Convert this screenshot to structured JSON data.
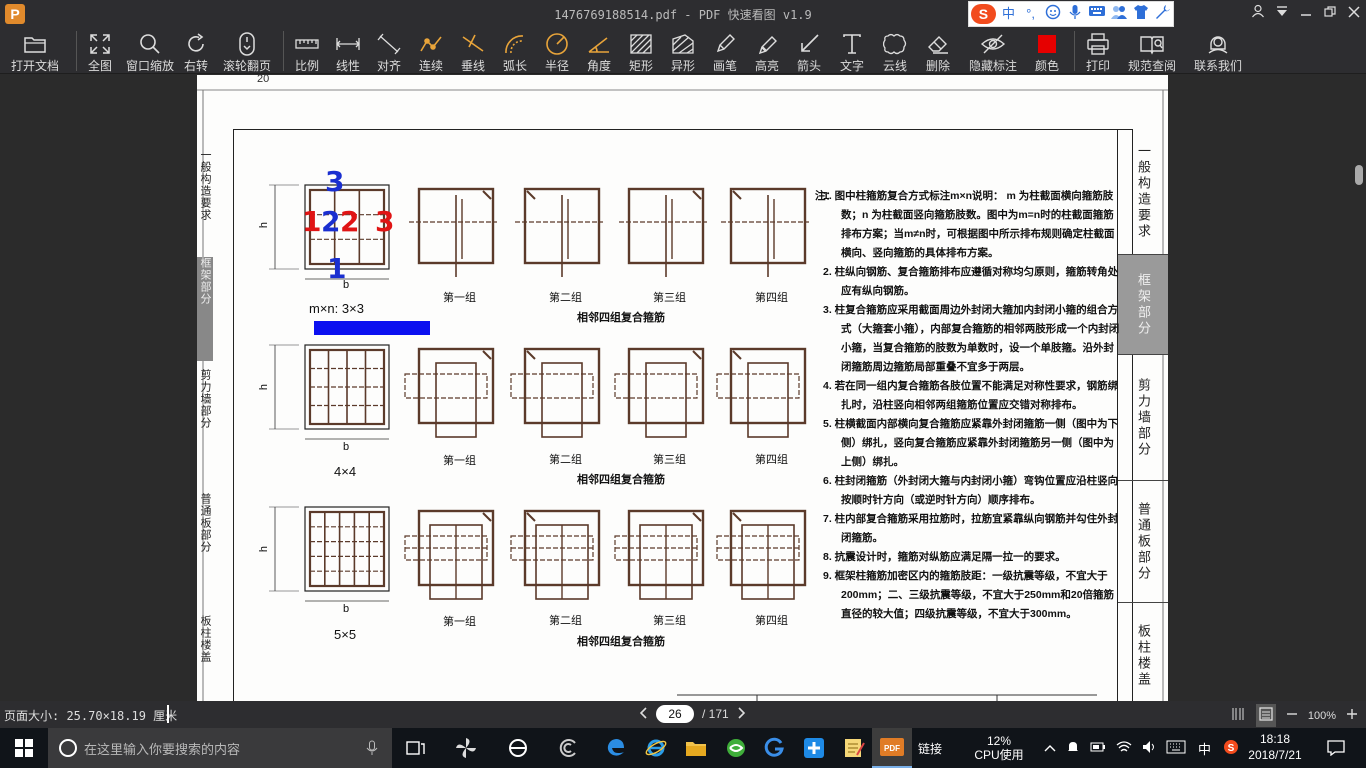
{
  "window": {
    "title": "1476769188514.pdf - PDF 快速看图 v1.9",
    "logo_text": "P",
    "controls": [
      "user-icon",
      "menu-icon",
      "minimize",
      "maximize",
      "close"
    ]
  },
  "ime": {
    "logo": "S",
    "items": [
      "中",
      "°,",
      "☺",
      "🎤",
      "⌨",
      "👥",
      "👕",
      "🔧"
    ]
  },
  "toolbar": {
    "items": [
      {
        "id": "open",
        "label": "打开文档",
        "icon": "folder-icon"
      },
      {
        "id": "fit",
        "label": "全图",
        "icon": "fullscreen-icon"
      },
      {
        "id": "window-zoom",
        "label": "窗口缩放",
        "icon": "magnifier-icon"
      },
      {
        "id": "rotate",
        "label": "右转",
        "icon": "rotate-icon"
      },
      {
        "id": "wheel-page",
        "label": "滚轮翻页",
        "icon": "mouse-icon"
      },
      {
        "id": "scale",
        "label": "比例",
        "icon": "ruler-icon"
      },
      {
        "id": "linear",
        "label": "线性",
        "icon": "linear-dimension-icon"
      },
      {
        "id": "align",
        "label": "对齐",
        "icon": "aligned-dimension-icon"
      },
      {
        "id": "continuous",
        "label": "连续",
        "icon": "continuous-dimension-icon"
      },
      {
        "id": "perpendicular",
        "label": "垂线",
        "icon": "perpendicular-icon"
      },
      {
        "id": "arc-length",
        "label": "弧长",
        "icon": "arc-length-icon"
      },
      {
        "id": "radius",
        "label": "半径",
        "icon": "radius-icon"
      },
      {
        "id": "angle",
        "label": "角度",
        "icon": "angle-icon"
      },
      {
        "id": "rectangle",
        "label": "矩形",
        "icon": "rectangle-area-icon"
      },
      {
        "id": "polygon",
        "label": "异形",
        "icon": "polygon-area-icon"
      },
      {
        "id": "pen",
        "label": "画笔",
        "icon": "pencil-icon"
      },
      {
        "id": "highlight",
        "label": "高亮",
        "icon": "highlighter-icon"
      },
      {
        "id": "arrow",
        "label": "箭头",
        "icon": "arrow-icon"
      },
      {
        "id": "text",
        "label": "文字",
        "icon": "text-icon"
      },
      {
        "id": "cloud",
        "label": "云线",
        "icon": "cloud-icon"
      },
      {
        "id": "delete",
        "label": "删除",
        "icon": "eraser-icon"
      },
      {
        "id": "hide",
        "label": "隐藏标注",
        "icon": "hide-eye-icon"
      },
      {
        "id": "color",
        "label": "颜色",
        "icon": "color-swatch-icon"
      },
      {
        "id": "print",
        "label": "打印",
        "icon": "printer-icon"
      },
      {
        "id": "spec",
        "label": "规范查阅",
        "icon": "book-icon"
      },
      {
        "id": "contact",
        "label": "联系我们",
        "icon": "contact-icon"
      }
    ],
    "color_swatch": "#e60000"
  },
  "document": {
    "page_corner_number": "20",
    "right_tabs": [
      "一般构造要求",
      "框架部分",
      "剪力墙部分",
      "普通板部分",
      "板柱楼盖"
    ],
    "right_active": 1,
    "left_tabs": [
      "一般构造要求",
      "框架部分",
      "剪力墙部分",
      "普通板部分",
      "板柱楼盖"
    ],
    "left_active": 1,
    "rows": [
      {
        "size": "m×n:  3×3",
        "dim_b": "b",
        "dim_h": "h",
        "groups": [
          "第一组",
          "第二组",
          "第三组",
          "第四组"
        ],
        "caption": "相邻四组复合箍筋"
      },
      {
        "size": "4×4",
        "dim_b": "b",
        "dim_h": "h",
        "groups": [
          "第一组",
          "第二组",
          "第三组",
          "第四组"
        ],
        "caption": "相邻四组复合箍筋"
      },
      {
        "size": "5×5",
        "dim_b": "b",
        "dim_h": "h",
        "groups": [
          "第一组",
          "第二组",
          "第三组",
          "第四组"
        ],
        "caption": "相邻四组复合箍筋"
      }
    ],
    "notes_head": "注：",
    "notes": [
      "1. 图中柱箍筋复合方式标注m×n说明：  m 为柱截面横向箍筋肢数；n 为柱截面竖向箍筋肢数。图中为m=n时的柱截面箍筋排布方案；当m≠n时，可根据图中所示排布规则确定柱截面横向、竖向箍筋的具体排布方案。",
      "2. 柱纵向钢筋、复合箍筋排布应遵循对称均匀原则，箍筋转角处应有纵向钢筋。",
      "3. 柱复合箍筋应采用截面周边外封闭大箍加内封闭小箍的组合方式（大箍套小箍），内部复合箍筋的相邻两肢形成一个内封闭小箍，当复合箍筋的肢数为单数时，设一个单肢箍。沿外封闭箍筋周边箍筋局部重叠不宜多于两层。",
      "4. 若在同一组内复合箍筋各肢位置不能满足对称性要求，钢筋绑扎时，沿柱竖向相邻两组箍筋位置应交错对称排布。",
      "5. 柱横截面内部横向复合箍筋应紧靠外封闭箍筋一侧（图中为下侧）绑扎，竖向复合箍筋应紧靠外封闭箍筋另一侧（图中为上侧）绑扎。",
      "6. 柱封闭箍筋（外封闭大箍与内封闭小箍）弯钩位置应沿柱竖向按顺时针方向（或逆时针方向）顺序排布。",
      "7. 柱内部复合箍筋采用拉筋时，拉筋宜紧靠纵向钢筋并勾住外封闭箍筋。",
      "8. 抗震设计时，箍筋对纵筋应满足隔一拉一的要求。",
      "9. 框架柱箍筋加密区内的箍筋肢距：一级抗震等级，不宜大于200mm；二、三级抗震等级，不宜大于250mm和20倍箍筋直径的较大值；四级抗震等级，不宜大于300mm。"
    ],
    "annotations": {
      "blue_top": "3",
      "red_left": "1",
      "blue_mid": "2",
      "red_mid": "2",
      "red_right": "3",
      "blue_bottom": "1",
      "blue_color": "#1a2fd0",
      "red_color": "#e01414",
      "bar_color": "#0b10f0"
    }
  },
  "statusbar": {
    "page_size": "页面大小: 25.70×18.19 厘米",
    "current_page": "26",
    "total_pages": "/ 171",
    "zoom": "100%"
  },
  "taskbar": {
    "search_placeholder": "在这里输入你要搜索的内容",
    "tray_link": "链接",
    "cpu_percent": "12%",
    "cpu_label": "CPU使用",
    "ime_lang": "中",
    "time": "18:18",
    "date": "2018/7/21"
  }
}
